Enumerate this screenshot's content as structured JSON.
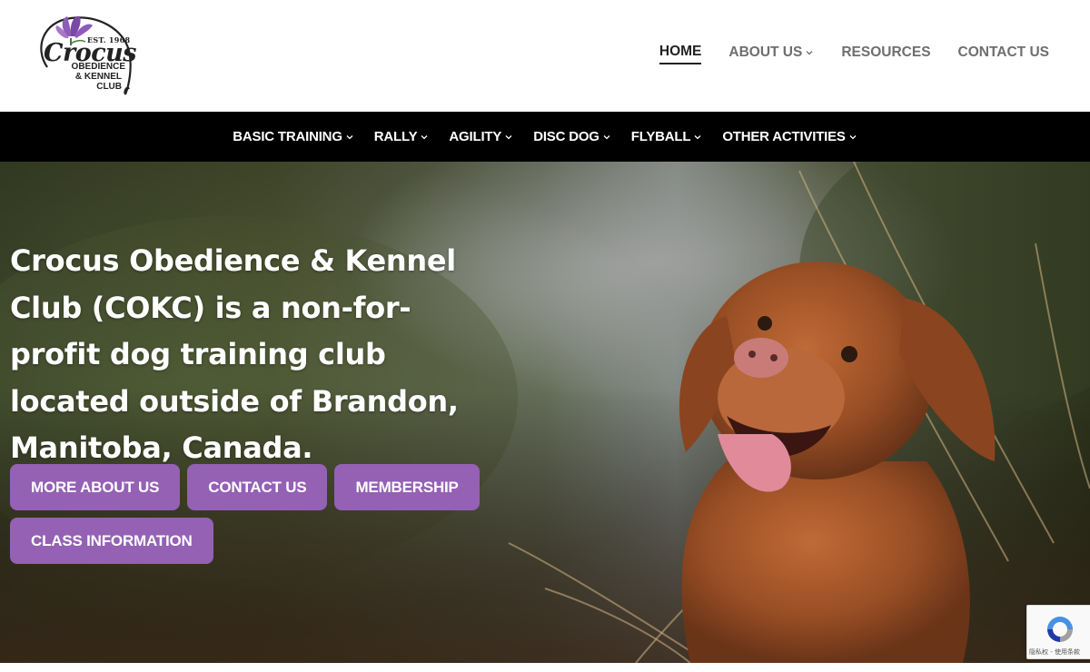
{
  "logo": {
    "est": "EST. 1968",
    "wordmark": "Crocus",
    "line1": "OBEDIENCE",
    "line2": "& KENNEL",
    "line3": "CLUB",
    "flower_color": "#8e5cb8"
  },
  "main_nav": {
    "items": [
      {
        "label": "HOME",
        "active": true,
        "has_dropdown": false
      },
      {
        "label": "ABOUT US",
        "active": false,
        "has_dropdown": true
      },
      {
        "label": "RESOURCES",
        "active": false,
        "has_dropdown": false
      },
      {
        "label": "CONTACT US",
        "active": false,
        "has_dropdown": false
      }
    ]
  },
  "activity_nav": {
    "items": [
      {
        "label": "BASIC TRAINING",
        "has_dropdown": true
      },
      {
        "label": "RALLY",
        "has_dropdown": true
      },
      {
        "label": "AGILITY",
        "has_dropdown": true
      },
      {
        "label": "DISC DOG",
        "has_dropdown": true
      },
      {
        "label": "FLYBALL",
        "has_dropdown": true
      },
      {
        "label": "OTHER ACTIVITIES",
        "has_dropdown": true
      }
    ]
  },
  "hero": {
    "headline": "Crocus Obedience & Kennel Club (COKC) is a non-for-profit dog training club located outside of Brandon, Manitoba, Canada.",
    "buttons": [
      {
        "label": "MORE ABOUT US"
      },
      {
        "label": "CONTACT US"
      },
      {
        "label": "MEMBERSHIP"
      },
      {
        "label": "CLASS INFORMATION"
      }
    ],
    "background_image": "dog-in-field-photo"
  },
  "recaptcha": {
    "links": "隐私权 - 使用条款",
    "icon": "recaptcha-icon"
  },
  "colors": {
    "accent": "#9461b5",
    "nav_bar": "#000000",
    "nav_text_active": "#222222",
    "nav_text": "#6e6e6e"
  }
}
